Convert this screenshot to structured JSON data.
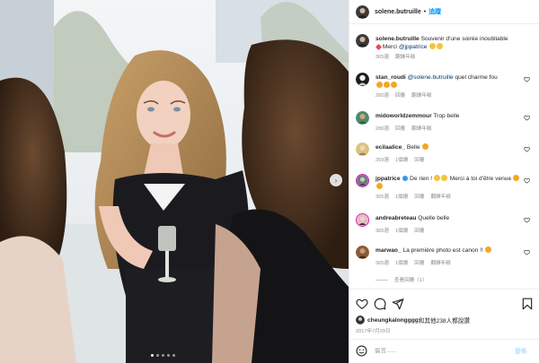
{
  "author": {
    "username": "solene.butruille",
    "follow_label": "追蹤",
    "separator": "•"
  },
  "caption": {
    "username": "solene.butruille",
    "text": "Souvenir d'une soirée inoubliable",
    "text2": "Merci",
    "mention": "@jppatrice",
    "time": "365週",
    "translate": "翻譯年糕"
  },
  "comments": [
    {
      "username": "stan_roudi",
      "mention": "@solene.butruille",
      "text": "quel charme fou",
      "time": "260週",
      "reply": "回覆",
      "translate": "翻譯年糕"
    },
    {
      "username": "midoworldzemmour",
      "text": "Trop belle",
      "time": "286週",
      "reply": "回覆",
      "translate": "翻譯年糕"
    },
    {
      "username": "ecilaalice_",
      "text": "Belle",
      "time": "359週",
      "likes": "1個讚",
      "reply": "回覆"
    },
    {
      "username": "jppatrice",
      "text": "De rien !",
      "text2": "Merci à toi d'être venue",
      "time": "365週",
      "likes": "1個讚",
      "reply": "回覆",
      "translate": "翻譯年糕"
    },
    {
      "username": "andreabreteau",
      "text": "Quelle belle",
      "time": "365週",
      "likes": "1個讚",
      "reply": "回覆"
    },
    {
      "username": "marwao_",
      "text": "La première photo est canon !!",
      "time": "365週",
      "likes": "1個讚",
      "reply": "回覆",
      "translate": "翻譯年糕"
    }
  ],
  "replies_label": "查看回覆（1）",
  "likes": {
    "username": "cheungkalongggg",
    "suffix": "和其他238人都說讚"
  },
  "date": "2017年7月29日",
  "comment_input": {
    "placeholder": "留言......",
    "post_label": "發佈"
  },
  "colors": {
    "link": "#0095f6",
    "heart_red": "#ed4956",
    "muted": "#8e8e8e"
  },
  "icons": [
    "heart-icon",
    "comment-icon",
    "share-icon",
    "bookmark-icon",
    "emoji-icon",
    "chevron-right-icon",
    "verified-icon"
  ],
  "carousel": {
    "slides": 5,
    "active": 1
  }
}
